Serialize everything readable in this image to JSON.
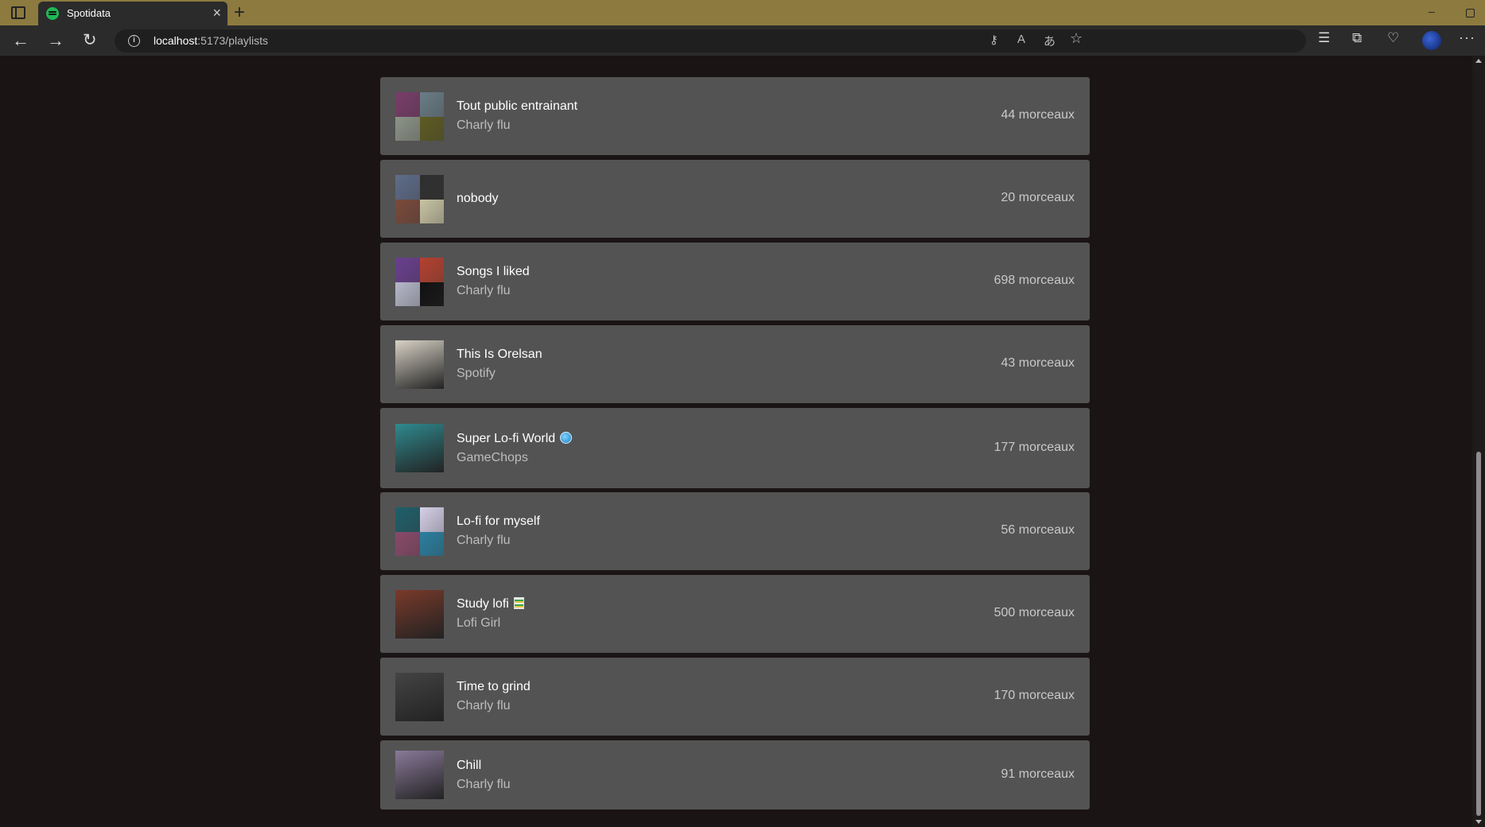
{
  "browser": {
    "tab_title": "Spotidata",
    "tab_close": "×",
    "new_tab": "+",
    "url_host": "localhost",
    "url_path": ":5173/playlists",
    "minimize": "–",
    "accent_color": "#8c7a3f"
  },
  "icons": {
    "back": "←",
    "forward": "→",
    "reload": "↻",
    "info": "i",
    "key": "⚷",
    "read_aloud": "A",
    "translate": "あ",
    "favorite": "☆",
    "favorites": "☰",
    "collections": "⧉",
    "performance": "♡",
    "more": "···"
  },
  "playlists": [
    {
      "name": "Tout public entrainant",
      "owner": "Charly flu",
      "count": "44 morceaux",
      "colors": [
        "#7a3d6a",
        "#6a7d86",
        "#8d9488",
        "#5e5b22"
      ]
    },
    {
      "name": "nobody",
      "owner": "",
      "count": "20 morceaux",
      "colors": [
        "#5f6d8a",
        "#2f2f2f",
        "#7a4a3a",
        "#c8c4a4"
      ]
    },
    {
      "name": "Songs I liked",
      "owner": "Charly flu",
      "count": "698 morceaux",
      "colors": [
        "#6a3f8f",
        "#b5412f",
        "#b6b8c9",
        "#111111"
      ]
    },
    {
      "name": "This Is Orelsan",
      "owner": "Spotify",
      "count": "43 morceaux",
      "colors": [
        "#d8d2c6"
      ]
    },
    {
      "name": "Super Lo-fi World",
      "owner": "GameChops",
      "count": "177 morceaux",
      "emoji": "globe",
      "colors": [
        "#2f8a8f"
      ]
    },
    {
      "name": "Lo-fi for myself",
      "owner": "Charly flu",
      "count": "56 morceaux",
      "colors": [
        "#1f5f6a",
        "#d6d0e8",
        "#8a4a6a",
        "#2a7fa0"
      ]
    },
    {
      "name": "Study lofi",
      "owner": "Lofi Girl",
      "count": "500 morceaux",
      "emoji": "books",
      "colors": [
        "#7a3a2a"
      ]
    },
    {
      "name": "Time to grind",
      "owner": "Charly flu",
      "count": "170 morceaux",
      "colors": [
        "#444444"
      ]
    },
    {
      "name": "Chill",
      "owner": "Charly flu",
      "count": "91 morceaux",
      "colors": [
        "#8a7a9a"
      ]
    }
  ]
}
